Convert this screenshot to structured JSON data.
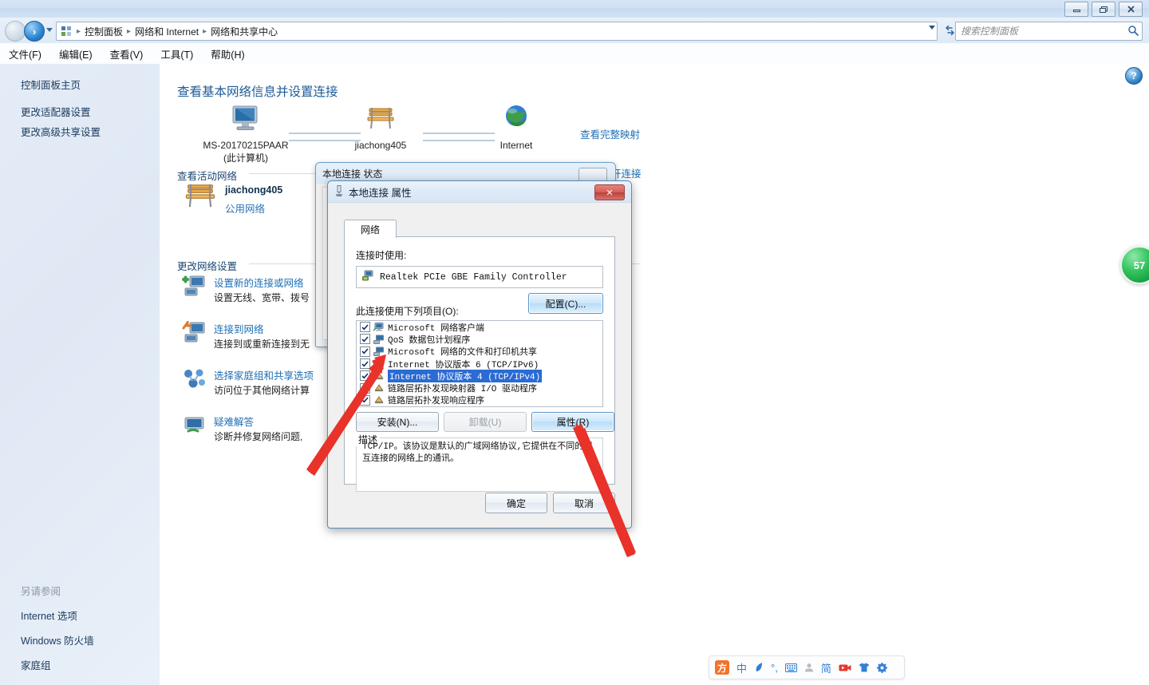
{
  "window": {
    "controls": {
      "minimize": "最小化",
      "restore": "还原",
      "close": "关闭"
    }
  },
  "address_bar": {
    "back_label": "后退",
    "forward_label": "前进",
    "breadcrumbs": [
      "控制面板",
      "网络和 Internet",
      "网络和共享中心"
    ],
    "separator": "▸",
    "refresh_label": "刷新",
    "search": {
      "placeholder": "搜索控制面板",
      "value": ""
    }
  },
  "menubar": {
    "items": [
      "文件(F)",
      "编辑(E)",
      "查看(V)",
      "工具(T)",
      "帮助(H)"
    ]
  },
  "sidebar": {
    "items": [
      "控制面板主页",
      "更改适配器设置",
      "更改高级共享设置"
    ],
    "see_also_heading": "另请参阅",
    "see_also_items": [
      "Internet 选项",
      "Windows 防火墙",
      "家庭组"
    ]
  },
  "main": {
    "page_title": "查看基本网络信息并设置连接",
    "help_label": "帮助",
    "network_map": {
      "nodes": [
        {
          "label": "MS-20170215PAAR",
          "sub": "(此计算机)",
          "icon": "computer-icon"
        },
        {
          "label": "jiachong405",
          "sub": "",
          "icon": "bench-icon"
        },
        {
          "label": "Internet",
          "sub": "",
          "icon": "globe-icon"
        }
      ],
      "full_map_link": "查看完整映射"
    },
    "active_networks_heading": "查看活动网络",
    "active_network": {
      "name": "jiachong405",
      "type": "公用网络",
      "connect_link": "开连接"
    },
    "change_settings_heading": "更改网络设置",
    "settings_items": [
      {
        "title": "设置新的连接或网络",
        "desc": "设置无线、宽带、拨号",
        "icon": "new-connection-icon"
      },
      {
        "title": "连接到网络",
        "desc": "连接到或重新连接到无",
        "icon": "connect-network-icon"
      },
      {
        "title": "选择家庭组和共享选项",
        "desc": "访问位于其他网络计算",
        "icon": "homegroup-icon"
      },
      {
        "title": "疑难解答",
        "desc": "诊断并修复网络问题,",
        "icon": "troubleshoot-icon"
      }
    ]
  },
  "background_dialog": {
    "title": "本地连接 状态",
    "close_label": "关闭"
  },
  "dialog": {
    "title": "本地连接 属性",
    "title_icon": "network-adapter-icon",
    "close_label": "关闭",
    "tabs": [
      "网络"
    ],
    "connect_using_label": "连接时使用:",
    "adapter": "Realtek PCIe GBE Family Controller",
    "adapter_icon": "network-card-icon",
    "configure_button": "配置(C)...",
    "items_label": "此连接使用下列项目(O):",
    "items": [
      {
        "label": "Microsoft 网络客户端",
        "checked": true,
        "selected": false,
        "icon": "client-icon"
      },
      {
        "label": "QoS 数据包计划程序",
        "checked": true,
        "selected": false,
        "icon": "service-icon"
      },
      {
        "label": "Microsoft 网络的文件和打印机共享",
        "checked": true,
        "selected": false,
        "icon": "service-icon"
      },
      {
        "label": "Internet 协议版本 6 (TCP/IPv6)",
        "checked": true,
        "selected": false,
        "icon": "protocol-icon"
      },
      {
        "label": "Internet 协议版本 4 (TCP/IPv4)",
        "checked": true,
        "selected": true,
        "icon": "protocol-icon"
      },
      {
        "label": "链路层拓扑发现映射器 I/O 驱动程序",
        "checked": true,
        "selected": false,
        "icon": "protocol-icon"
      },
      {
        "label": "链路层拓扑发现响应程序",
        "checked": true,
        "selected": false,
        "icon": "protocol-icon"
      }
    ],
    "install_button": "安装(N)...",
    "uninstall_button": "卸载(U)",
    "properties_button": "属性(R)",
    "description_legend": "描述",
    "description_text": "TCP/IP。该协议是默认的广域网络协议,它提供在不同的相互连接的网络上的通讯。",
    "ok_button": "确定",
    "cancel_button": "取消"
  },
  "badge": {
    "value": "57"
  },
  "ime_bar": {
    "logo": "方",
    "items": [
      {
        "name": "chinese-mode-icon",
        "glyph": "中"
      },
      {
        "name": "moon-icon",
        "glyph": "☽"
      },
      {
        "name": "punctuation-icon",
        "glyph": "°,"
      },
      {
        "name": "soft-keyboard-icon",
        "glyph": "⌨"
      },
      {
        "name": "user-icon",
        "glyph": "👤"
      },
      {
        "name": "simplified-icon",
        "glyph": "简"
      },
      {
        "name": "video-icon",
        "glyph": "▶"
      },
      {
        "name": "skin-icon",
        "glyph": "👕"
      },
      {
        "name": "settings-gear-icon",
        "glyph": "⚙"
      }
    ]
  },
  "colors": {
    "accent_blue": "#1f6fb5",
    "title_blue": "#1f5c99",
    "selection_blue": "#2a6bd4",
    "badge_green": "#17a344",
    "annotation_red": "#e8322a",
    "ime_orange": "#f4722b"
  }
}
